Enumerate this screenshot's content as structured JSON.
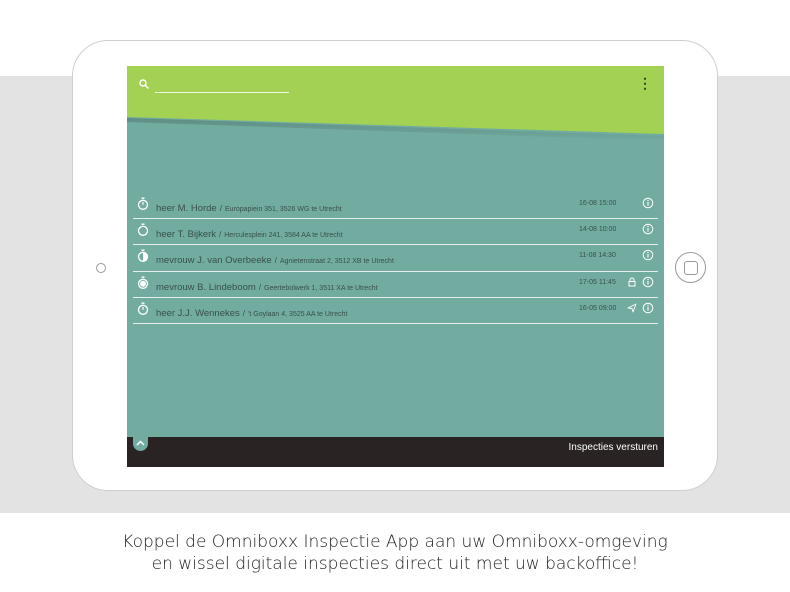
{
  "search": {
    "value": "",
    "placeholder": ""
  },
  "header": {
    "accent_color": "#a3d154",
    "menu_icon": "vertical-dots-icon"
  },
  "inspections": [
    {
      "icon": "stopwatch-icon",
      "name": "heer M. Horde",
      "address": "Europapiein 351, 3526 WG te Utrecht",
      "datetime": "16-08 15:00",
      "status_icon": "",
      "info_icon": "info-icon"
    },
    {
      "icon": "stopwatch-empty-icon",
      "name": "heer T. Bijkerk",
      "address": "Herculesplein 241, 3584 AA te Utrecht",
      "datetime": "14-08 10:00",
      "status_icon": "",
      "info_icon": "info-icon"
    },
    {
      "icon": "stopwatch-half-icon",
      "name": "mevrouw J. van Overbeeke",
      "address": "Agnietenstraat 2, 3512 XB te Utrecht",
      "datetime": "11-08 14:30",
      "status_icon": "",
      "info_icon": "info-icon"
    },
    {
      "icon": "stopwatch-full-icon",
      "name": "mevrouw B. Lindeboom",
      "address": "Geertebolwerk 1, 3511 XA te Utrecht",
      "datetime": "17-05 11:45",
      "status_icon": "lock-icon",
      "info_icon": "info-icon"
    },
    {
      "icon": "stopwatch-icon",
      "name": "heer J.J. Wennekes",
      "address": "'t Goylaan 4, 3525 AA te Utrecht",
      "datetime": "16-05 09:00",
      "status_icon": "send-icon",
      "info_icon": "info-icon"
    }
  ],
  "footer": {
    "send_label": "Inspecties versturen",
    "expand_icon": "chevron-up-icon"
  },
  "caption": {
    "line1": "Koppel de Omniboxx Inspectie App aan uw Omniboxx-omgeving",
    "line2": "en wissel digitale inspecties direct uit met uw backoffice!"
  }
}
